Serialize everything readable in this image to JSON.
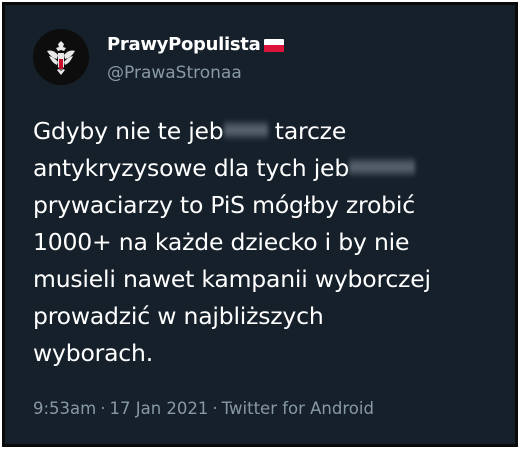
{
  "tweet": {
    "display_name": "PrawyPopulista",
    "handle": "@PrawaStronaa",
    "flag_icon": "poland-flag-icon",
    "avatar_icon": "polish-eagle-emblem-icon",
    "text_lines": {
      "line1_before": "Gdyby nie te jeb",
      "line1_after": " tarcze",
      "line2_before": "antykryzysowe dla tych jeb",
      "line3": "prywaciarzy to PiS mógłby zrobić",
      "line4": "1000+ na każde dziecko i by nie",
      "line5": "musieli nawet kampanii wyborczej",
      "line6": "prowadzić w najbliższych",
      "line7": "wyborach."
    },
    "time": "9:53am",
    "date": "17 Jan 2021",
    "source": "Twitter for Android",
    "separator": "·"
  },
  "colors": {
    "background": "#15202b",
    "text": "#ffffff",
    "secondary_text": "#8899a6",
    "flag_red": "#dc143c"
  }
}
